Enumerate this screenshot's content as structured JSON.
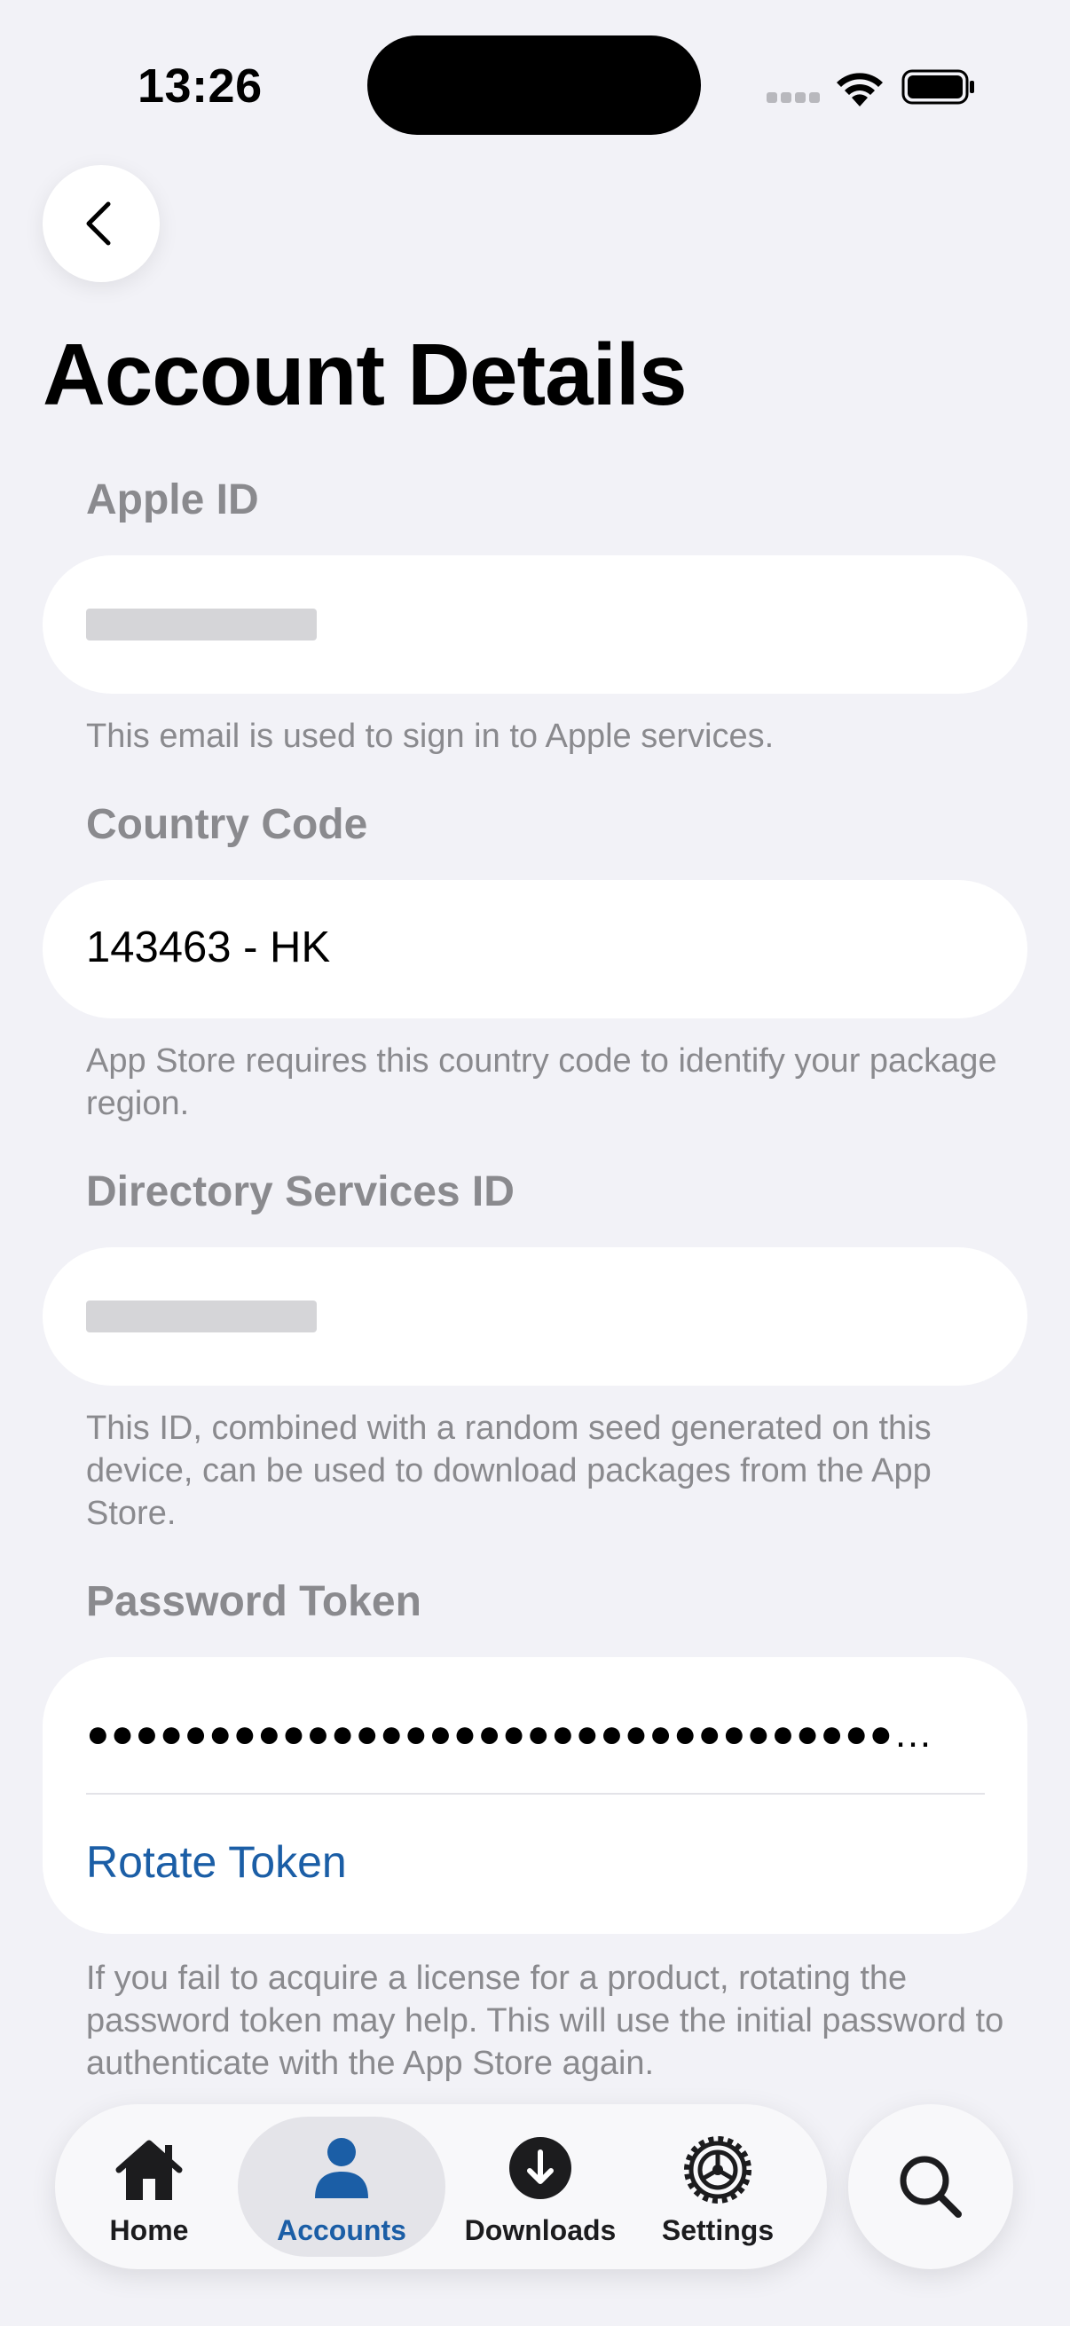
{
  "status_bar": {
    "time": "13:26"
  },
  "header": {
    "title": "Account Details"
  },
  "apple_id": {
    "label": "Apple ID",
    "value": "",
    "help": "This email is used to sign in to Apple services."
  },
  "country_code": {
    "label": "Country Code",
    "value": "143463 - HK",
    "help": "App Store requires this country code to identify your package region."
  },
  "directory_services_id": {
    "label": "Directory Services ID",
    "value": "",
    "help": "This ID, combined with a random seed generated on this device, can be used to download packages from the App Store."
  },
  "password_token": {
    "label": "Password Token",
    "masked_value": "●●●●●●●●●●●●●●●●●●●●●●●●●●●●●●●●●…",
    "rotate_label": "Rotate Token",
    "help": "If you fail to acquire a license for a product, rotating the password token may help. This will use the initial password to authenticate with the App Store again."
  },
  "tab_bar": {
    "tabs": [
      {
        "label": "Home",
        "icon": "house-icon"
      },
      {
        "label": "Accounts",
        "icon": "person-icon",
        "selected": true
      },
      {
        "label": "Downloads",
        "icon": "download-circle-icon"
      },
      {
        "label": "Settings",
        "icon": "gear-icon"
      }
    ],
    "search_icon": "magnifying-glass-icon"
  },
  "colors": {
    "accent": "#1b5ea6",
    "background": "#f2f2f7",
    "secondary_text": "#8a8a8e"
  }
}
